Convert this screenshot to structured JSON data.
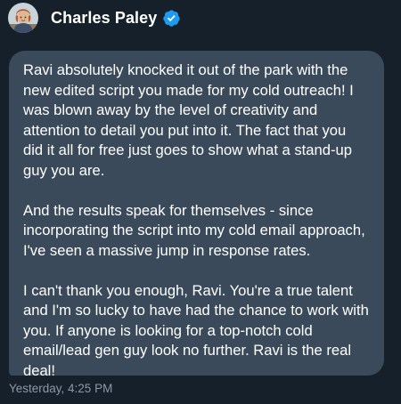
{
  "sender": {
    "name": "Charles Paley",
    "avatar_icon": "profile-photo",
    "verified_icon": "verified-badge-icon",
    "verified_color": "#1d9bf0"
  },
  "message": {
    "paragraphs": [
      "Ravi absolutely knocked it out of the park with the\nnew edited script you made for my cold outreach! I\nwas blown away by the level of creativity and\nattention to detail you put into it. The fact that you\ndid it all for free just goes to show what a stand-up\nguy you are.",
      "And the results speak for themselves - since\nincorporating the script into my cold email approach,\nI've seen a massive jump in response rates.",
      "I can't thank you enough, Ravi. You're a true talent\nand I'm so lucky to have had the chance to work with\nyou. If anyone is looking for a top-notch cold\nemail/lead gen guy look no further. Ravi is the real\ndeal!"
    ],
    "bubble_color": "#3a4a5b"
  },
  "timestamp": "Yesterday, 4:25 PM",
  "background_color": "#15202b"
}
